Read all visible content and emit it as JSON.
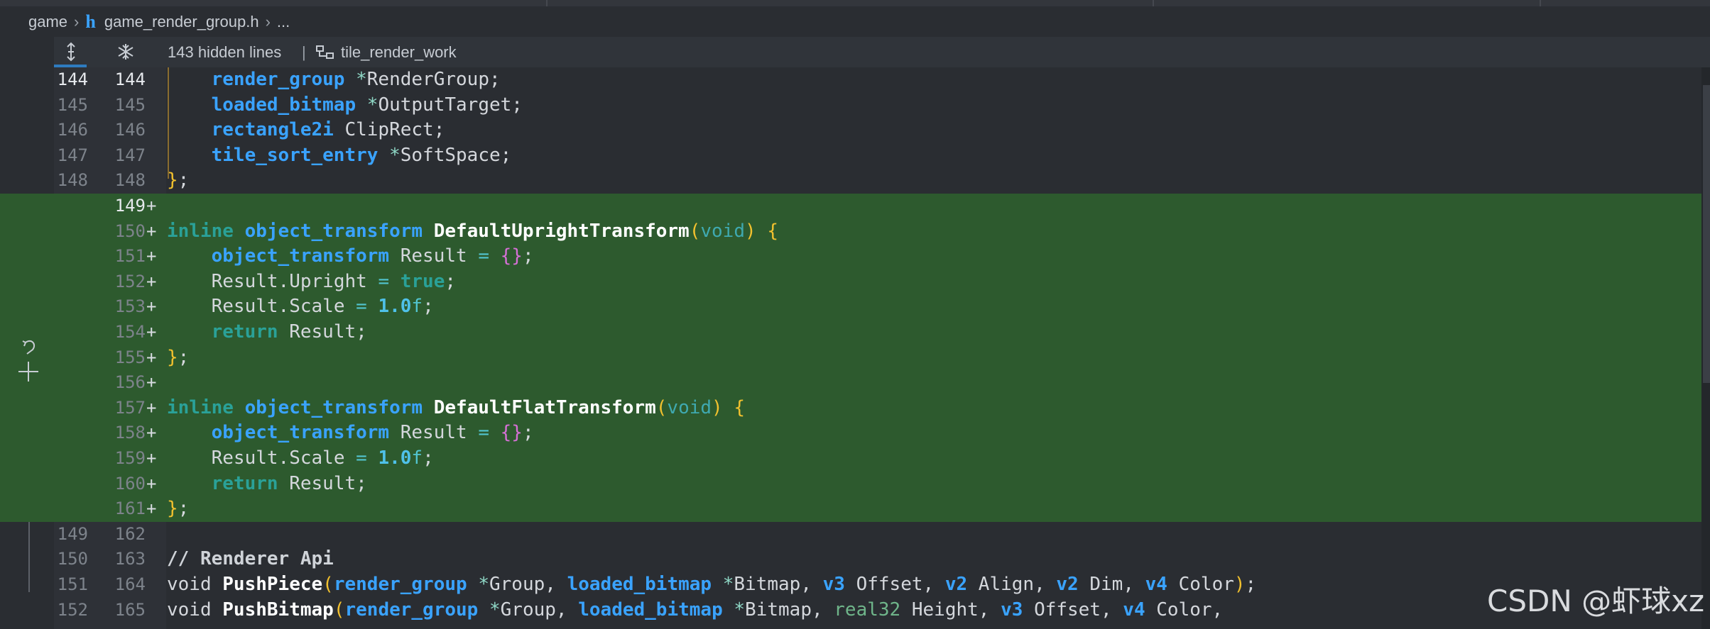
{
  "breadcrumb": {
    "folder": "game",
    "file": "game_render_group.h",
    "more": "..."
  },
  "hidden_bar": {
    "hidden_label": "143 hidden lines",
    "separator": "|",
    "symbol": "tile_render_work"
  },
  "code_rows": [
    {
      "old": "144",
      "new": "144",
      "added": false,
      "current": true,
      "text": "    render_group *RenderGroup;"
    },
    {
      "old": "145",
      "new": "145",
      "added": false,
      "current": false,
      "text": "    loaded_bitmap *OutputTarget;"
    },
    {
      "old": "146",
      "new": "146",
      "added": false,
      "current": false,
      "text": "    rectangle2i ClipRect;"
    },
    {
      "old": "147",
      "new": "147",
      "added": false,
      "current": false,
      "text": "    tile_sort_entry *SoftSpace;"
    },
    {
      "old": "148",
      "new": "148",
      "added": false,
      "current": false,
      "text": "};"
    },
    {
      "old": "",
      "new": "149",
      "added": true,
      "current": true,
      "text": ""
    },
    {
      "old": "",
      "new": "150",
      "added": true,
      "current": false,
      "text": "inline object_transform DefaultUprightTransform(void) {"
    },
    {
      "old": "",
      "new": "151",
      "added": true,
      "current": false,
      "text": "    object_transform Result = {};"
    },
    {
      "old": "",
      "new": "152",
      "added": true,
      "current": false,
      "text": "    Result.Upright = true;"
    },
    {
      "old": "",
      "new": "153",
      "added": true,
      "current": false,
      "text": "    Result.Scale = 1.0f;"
    },
    {
      "old": "",
      "new": "154",
      "added": true,
      "current": false,
      "text": "    return Result;"
    },
    {
      "old": "",
      "new": "155",
      "added": true,
      "current": false,
      "text": "};"
    },
    {
      "old": "",
      "new": "156",
      "added": true,
      "current": false,
      "text": ""
    },
    {
      "old": "",
      "new": "157",
      "added": true,
      "current": false,
      "text": "inline object_transform DefaultFlatTransform(void) {"
    },
    {
      "old": "",
      "new": "158",
      "added": true,
      "current": false,
      "text": "    object_transform Result = {};"
    },
    {
      "old": "",
      "new": "159",
      "added": true,
      "current": false,
      "text": "    Result.Scale = 1.0f;"
    },
    {
      "old": "",
      "new": "160",
      "added": true,
      "current": false,
      "text": "    return Result;"
    },
    {
      "old": "",
      "new": "161",
      "added": true,
      "current": false,
      "text": "};"
    },
    {
      "old": "149",
      "new": "162",
      "added": false,
      "current": false,
      "text": ""
    },
    {
      "old": "150",
      "new": "163",
      "added": false,
      "current": false,
      "text": "// Renderer Api"
    },
    {
      "old": "151",
      "new": "164",
      "added": false,
      "current": false,
      "text": "void PushPiece(render_group *Group, loaded_bitmap *Bitmap, v3 Offset, v2 Align, v2 Dim, v4 Color);"
    },
    {
      "old": "152",
      "new": "165",
      "added": false,
      "current": false,
      "text": "void PushBitmap(render_group *Group, loaded_bitmap *Bitmap, real32 Height, v3 Offset, v4 Color,"
    }
  ],
  "plus_marker": "+",
  "watermark": "CSDN @虾球xz",
  "colors": {
    "added_line_bg": "#2d5a2e",
    "type_keyword": "#3aa3ff",
    "control_keyword": "#2aa198",
    "accent_blue": "#2e7bbf"
  },
  "icons": {
    "expand": "expand-lines-icon",
    "fold": "fold-hidden-lines-icon",
    "struct": "struct-symbol-icon",
    "revert": "revert-change-icon",
    "stage": "stage-change-icon"
  }
}
